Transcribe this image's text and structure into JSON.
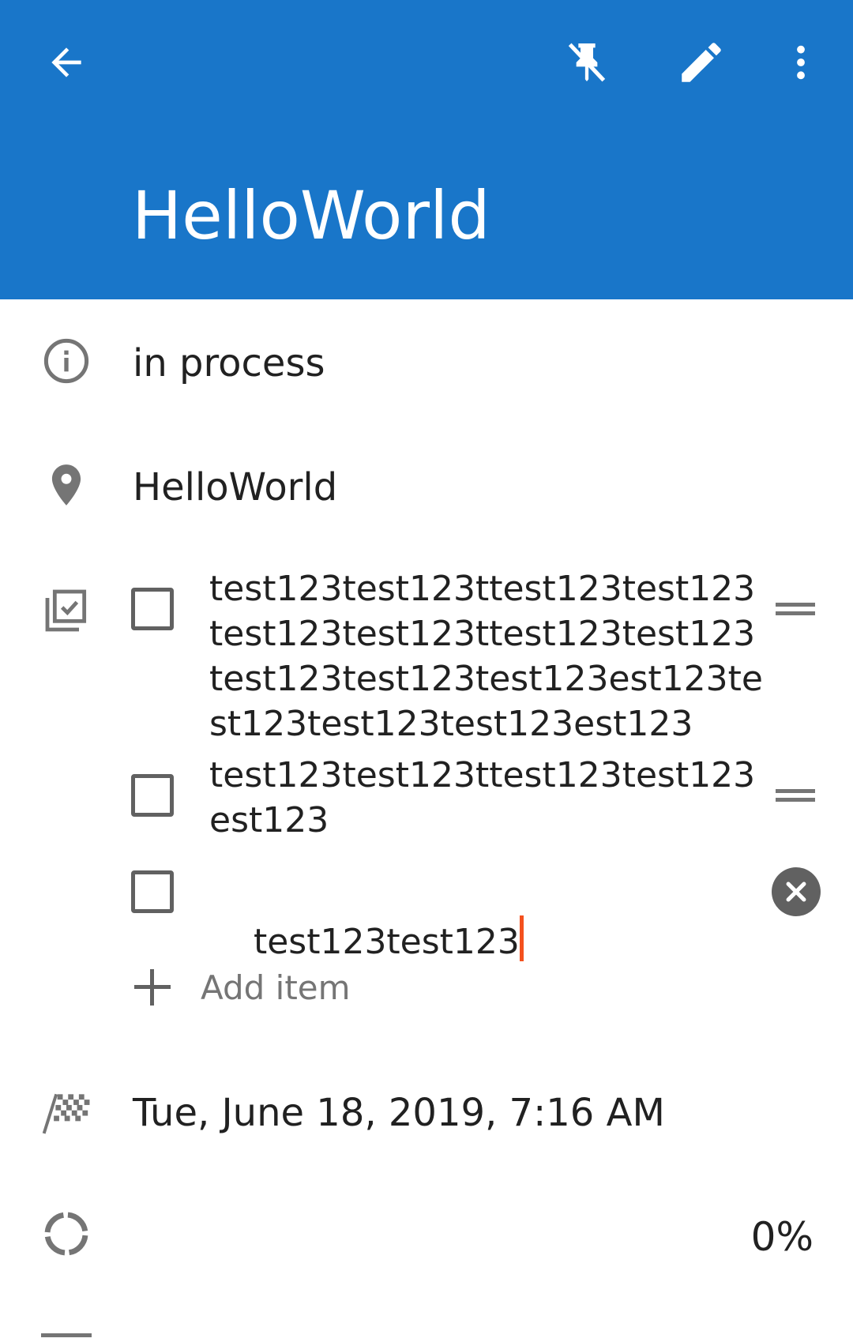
{
  "appbar": {
    "title": "HelloWorld",
    "background": "#1976c9",
    "icons": {
      "back": "arrow-back-icon",
      "unpin": "pin-off-icon",
      "edit": "pencil-icon",
      "more": "more-vert-icon"
    }
  },
  "details": {
    "status": "in process",
    "location": "HelloWorld",
    "due_date": "Tue, June 18, 2019, 7:16 AM",
    "progress": "0%",
    "progress_fraction": 0
  },
  "checklist": {
    "items": [
      {
        "text": "test123test123ttest123test123\ntest123test123ttest123test123\ntest123test123test123est123te\nst123test123test123est123",
        "checked": false
      },
      {
        "text": "test123test123ttest123test123\nest123",
        "checked": false
      },
      {
        "text": "test123test123",
        "checked": false,
        "editing": true
      }
    ],
    "add_label": "Add item"
  },
  "colors": {
    "accent": "#1976c9",
    "caret": "#f4511e",
    "icon": "#757575",
    "text": "#212121"
  }
}
